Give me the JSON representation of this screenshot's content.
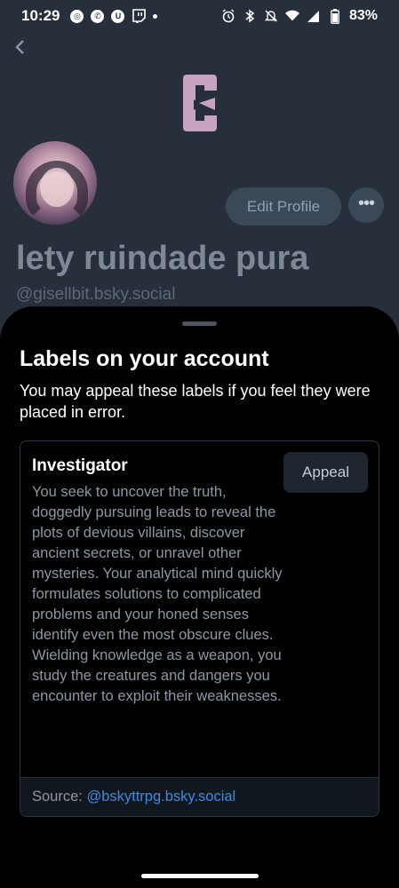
{
  "status_bar": {
    "time": "10:29",
    "battery": "83%",
    "notification_icons": [
      "target-icon",
      "whatsapp-icon",
      "uber-icon",
      "twitch-icon",
      "dot-icon"
    ],
    "system_icons": [
      "alarm-icon",
      "bluetooth-icon",
      "mute-icon",
      "wifi-icon",
      "signal-icon",
      "battery-icon"
    ]
  },
  "profile": {
    "edit_profile_label": "Edit Profile",
    "more_label": "•••",
    "display_name": "lety ruindade pura",
    "handle": "@gisellbit.bsky.social",
    "banner_color": "#c8a3c0"
  },
  "sheet": {
    "title": "Labels on your account",
    "subtitle": "You may appeal these labels if you feel they were placed in error.",
    "labels": [
      {
        "name": "Investigator",
        "description": "You seek to uncover the truth, doggedly pursuing leads to reveal the plots of devious villains, discover ancient secrets, or unravel other mysteries. Your analytical mind quickly formulates solutions to complicated problems and your honed senses identify even the most obscure clues. Wielding knowledge as a weapon, you study the creatures and dangers you encounter to exploit their weaknesses.",
        "appeal_label": "Appeal",
        "source_prefix": "Source: ",
        "source_handle": "@bskyttrpg.bsky.social"
      }
    ]
  },
  "colors": {
    "link": "#3a8be6",
    "sheet_bg": "#000000",
    "dim_bg": "#262f3a"
  }
}
